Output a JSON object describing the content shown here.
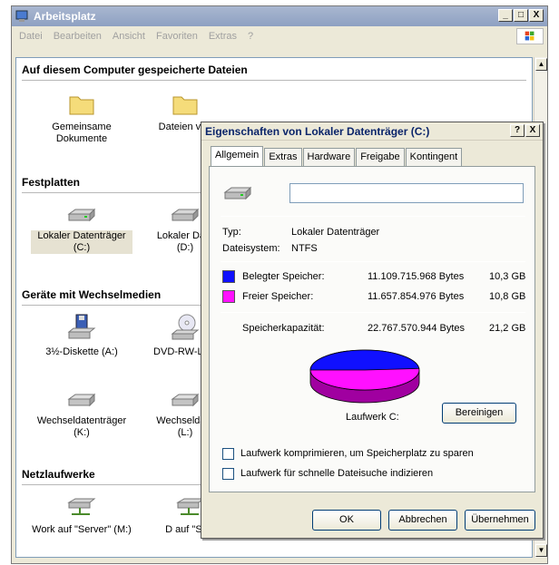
{
  "window": {
    "title": "Arbeitsplatz",
    "controls": {
      "minimize": "_",
      "maximize": "□",
      "close": "X"
    },
    "menu": [
      "Datei",
      "Bearbeiten",
      "Ansicht",
      "Favoriten",
      "Extras",
      "?"
    ]
  },
  "sections": {
    "stored_files": {
      "heading": "Auf diesem Computer gespeicherte Dateien",
      "items": [
        "Gemeinsame Dokumente",
        "Dateien von"
      ]
    },
    "hard_drives": {
      "heading": "Festplatten",
      "items": [
        {
          "line1": "Lokaler Datenträger",
          "line2": "(C:)"
        },
        {
          "line1": "Lokaler Date",
          "line2": "(D:)"
        }
      ]
    },
    "removable": {
      "heading": "Geräte mit Wechselmedien",
      "items": [
        {
          "line1": "3½-Diskette (A:)",
          "line2": ""
        },
        {
          "line1": "DVD-RW-Lauf",
          "line2": ""
        },
        {
          "line1": "Wechseldatenträger",
          "line2": "(K:)"
        },
        {
          "line1": "Wechseldate",
          "line2": "(L:)"
        }
      ]
    },
    "network": {
      "heading": "Netzlaufwerke",
      "items": [
        "Work auf \"Server\" (M:)",
        "D auf \"Serv"
      ]
    }
  },
  "dialog": {
    "title": "Eigenschaften von Lokaler Datenträger (C:)",
    "help": "?",
    "close": "X",
    "tabs": [
      "Allgemein",
      "Extras",
      "Hardware",
      "Freigabe",
      "Kontingent"
    ],
    "name_value": "",
    "type_label": "Typ:",
    "type_value": "Lokaler Datenträger",
    "fs_label": "Dateisystem:",
    "fs_value": "NTFS",
    "used_label": "Belegter Speicher:",
    "used_bytes": "11.109.715.968 Bytes",
    "used_gb": "10,3 GB",
    "free_label": "Freier Speicher:",
    "free_bytes": "11.657.854.976 Bytes",
    "free_gb": "10,8 GB",
    "capacity_label": "Speicherkapazität:",
    "capacity_bytes": "22.767.570.944 Bytes",
    "capacity_gb": "21,2 GB",
    "drive_label": "Laufwerk C:",
    "cleanup_button": "Bereinigen",
    "compress_label": "Laufwerk komprimieren, um Speicherplatz zu sparen",
    "index_label": "Laufwerk für schnelle Dateisuche indizieren",
    "ok_button": "OK",
    "cancel_button": "Abbrechen",
    "apply_button": "Übernehmen",
    "colors": {
      "used": "#1010ff",
      "free": "#ff10ff"
    },
    "used_fraction": 0.488
  }
}
